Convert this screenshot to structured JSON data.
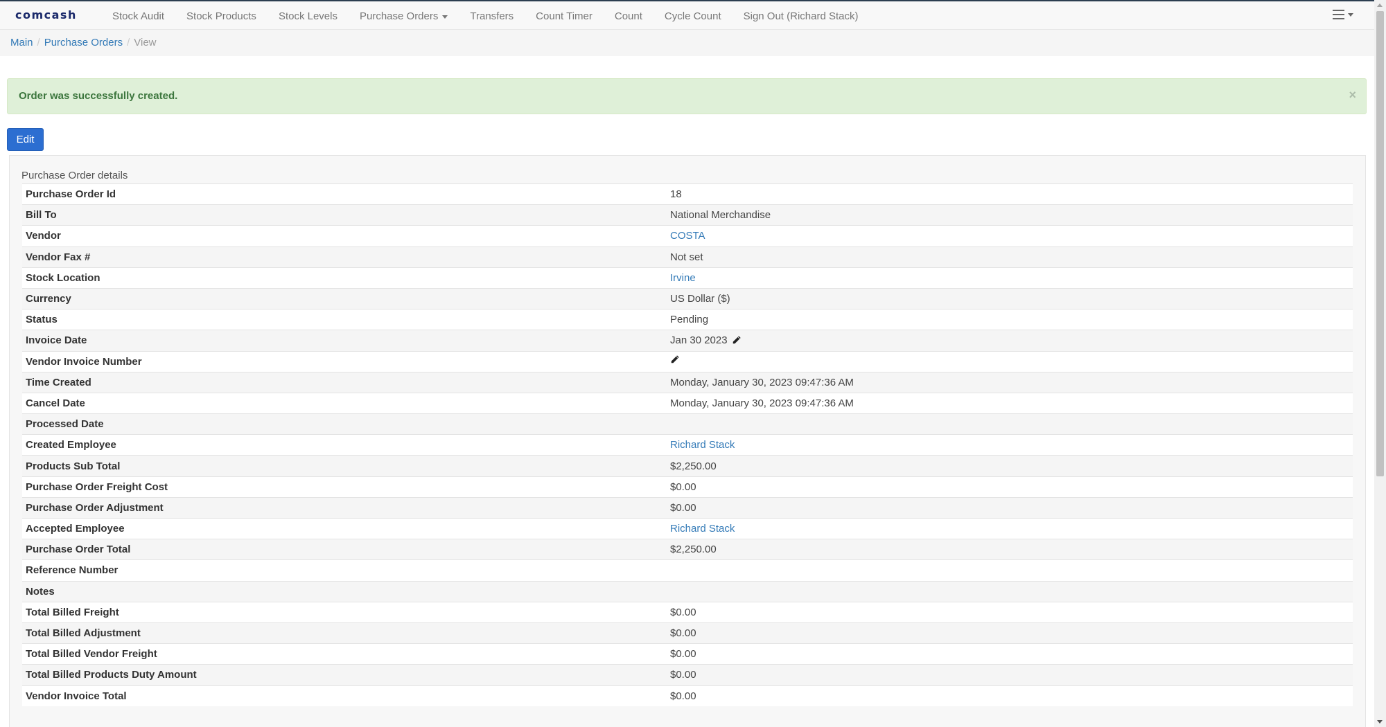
{
  "navbar": {
    "brand": "comcash",
    "items": [
      {
        "label": "Stock Audit"
      },
      {
        "label": "Stock Products"
      },
      {
        "label": "Stock Levels"
      },
      {
        "label": "Purchase Orders"
      },
      {
        "label": "Transfers"
      },
      {
        "label": "Count Timer"
      },
      {
        "label": "Count"
      },
      {
        "label": "Cycle Count"
      },
      {
        "label": "Sign Out (Richard Stack)"
      }
    ],
    "menu_icon": "hamburger-menu-icon"
  },
  "breadcrumb": {
    "items": [
      "Main",
      "Purchase Orders"
    ],
    "active": "View"
  },
  "alert": {
    "message": "Order was successfully created.",
    "close": "×"
  },
  "toolbar": {
    "edit_label": "Edit"
  },
  "panel": {
    "title": "Purchase Order details",
    "rows": [
      {
        "label": "Purchase Order Id",
        "value": "18"
      },
      {
        "label": "Bill To",
        "value": "National Merchandise"
      },
      {
        "label": "Vendor",
        "value": "COSTA"
      },
      {
        "label": "Vendor Fax #",
        "value": "Not set"
      },
      {
        "label": "Stock Location",
        "value": "Irvine"
      },
      {
        "label": "Currency",
        "value": "US Dollar ($)"
      },
      {
        "label": "Status",
        "value": "Pending"
      },
      {
        "label": "Invoice Date",
        "value": "Jan 30 2023"
      },
      {
        "label": "Vendor Invoice Number",
        "value": ""
      },
      {
        "label": "Time Created",
        "value": "Monday, January 30, 2023 09:47:36 AM"
      },
      {
        "label": "Cancel Date",
        "value": "Monday, January 30, 2023 09:47:36 AM"
      },
      {
        "label": "Processed Date",
        "value": ""
      },
      {
        "label": "Created Employee",
        "value": "Richard Stack"
      },
      {
        "label": "Products Sub Total",
        "value": "$2,250.00"
      },
      {
        "label": "Purchase Order Freight Cost",
        "value": "$0.00"
      },
      {
        "label": "Purchase Order Adjustment",
        "value": "$0.00"
      },
      {
        "label": "Accepted Employee",
        "value": "Richard Stack"
      },
      {
        "label": "Purchase Order Total",
        "value": "$2,250.00"
      },
      {
        "label": "Reference Number",
        "value": ""
      },
      {
        "label": "Notes",
        "value": ""
      },
      {
        "label": "Total Billed Freight",
        "value": "$0.00"
      },
      {
        "label": "Total Billed Adjustment",
        "value": "$0.00"
      },
      {
        "label": "Total Billed Vendor Freight",
        "value": "$0.00"
      },
      {
        "label": "Total Billed Products Duty Amount",
        "value": "$0.00"
      },
      {
        "label": "Vendor Invoice Total",
        "value": "$0.00"
      }
    ]
  },
  "colors": {
    "link": "#337ab7",
    "alert_bg": "#dff0d8",
    "alert_text": "#3c763d",
    "primary_button": "#2c6ed1",
    "brand": "#1b2a6b"
  }
}
